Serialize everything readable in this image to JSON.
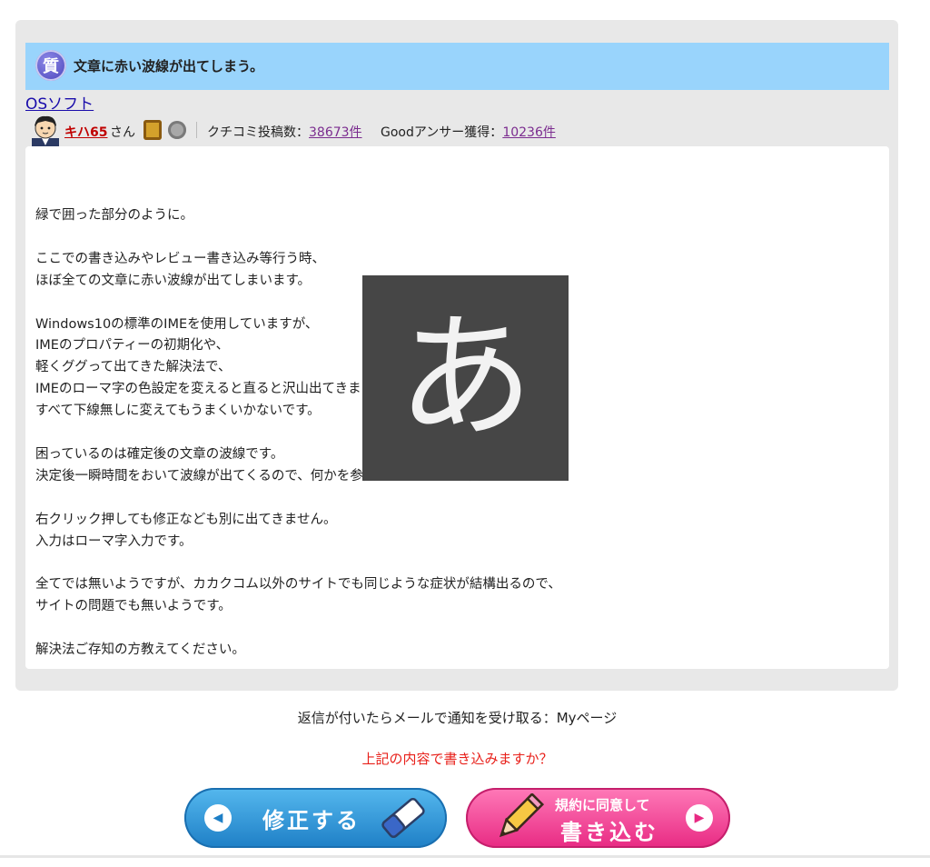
{
  "question": {
    "icon_char": "質",
    "title": "文章に赤い波線が出てしまう。"
  },
  "category": "OSソフト",
  "user": {
    "name": "キハ65",
    "suffix": "さん",
    "posts_label": "クチコミ投稿数：",
    "posts_value": "38673件",
    "good_label": "Goodアンサー獲得：",
    "good_value": "10236件"
  },
  "body_text": "緑で囲った部分のように。\n\nここでの書き込みやレビュー書き込み等行う時、\nほぼ全ての文章に赤い波線が出てしまいます。\n\nWindows10の標準のIMEを使用していますが、\nIMEのプロパティーの初期化や、\n軽くググって出てきた解決法で、\nIMEのローマ字の色設定を変えると直ると沢山出てきましたが、\nすべて下線無しに変えてもうまくいかないです。\n\n困っているのは確定後の文章の波線です。\n決定後一瞬時間をおいて波線が出てくるので、何かを参照しているような気もしますが…\n\n右クリック押しても修正なども別に出てきません。\n入力はローマ字入力です。\n\n全てでは無いようですが、カカクコム以外のサイトでも同じような症状が結構出るので、\nサイトの問題でも無いようです。\n\n解決法ご存知の方教えてください。",
  "ime_indicator": "あ",
  "notify_text": "返信が付いたらメールで通知を受け取る：Myページ",
  "confirm_text": "上記の内容で書き込みますか？",
  "buttons": {
    "edit_label": "修正する",
    "submit_line1": "規約に同意して",
    "submit_line2": "書き込む"
  },
  "colors": {
    "question_bar": "#99d4fc",
    "panel_bg": "#e8e8e8",
    "edit_button": "#1e7fc6",
    "submit_button": "#e82a83",
    "confirm_text": "#e8201a"
  },
  "icons": [
    "question-badge-icon",
    "avatar-icon",
    "gold-medal-icon",
    "silver-medal-icon",
    "arrow-left-icon",
    "eraser-icon",
    "pencil-icon",
    "arrow-right-icon"
  ]
}
